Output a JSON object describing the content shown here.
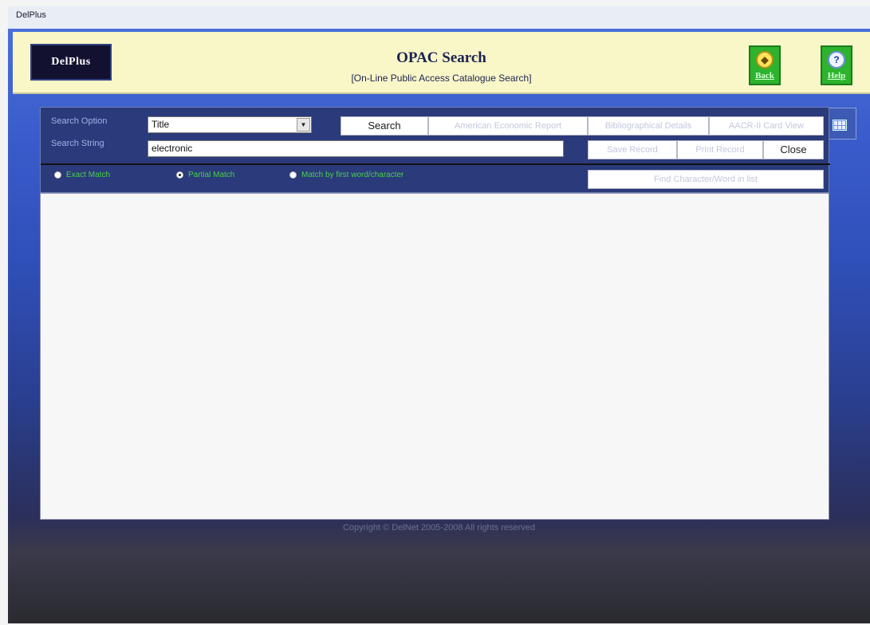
{
  "window": {
    "title": "DelPlus"
  },
  "header": {
    "logo_text": "DelPlus",
    "title": "OPAC Search",
    "subtitle": "[On-Line Public Access Catalogue Search]",
    "back_label": "Back",
    "help_label": "Help"
  },
  "search": {
    "option_label": "Search Option",
    "option_value": "Title",
    "string_label": "Search String",
    "string_value": "electronic",
    "search_button": "Search",
    "report_button": "American Economic Report",
    "biblio_button": "Bibliographical Details",
    "aacr_button": "AACR-II Card View",
    "save_button": "Save Record",
    "print_button": "Print Record",
    "close_button": "Close",
    "find_button": "Find Character/Word in list"
  },
  "match_options": {
    "exact": "Exact Match",
    "partial": "Partial Match",
    "first_word": "Match by first word/character",
    "selected": "partial"
  },
  "footer": {
    "copyright": "Copyright © DelNet 2005-2008 All rights reserved"
  },
  "colors": {
    "header_bg": "#f9f6c8",
    "app_blue": "#3a5ccc",
    "button_green": "#2db32d",
    "radio_text": "#4ad04a"
  }
}
